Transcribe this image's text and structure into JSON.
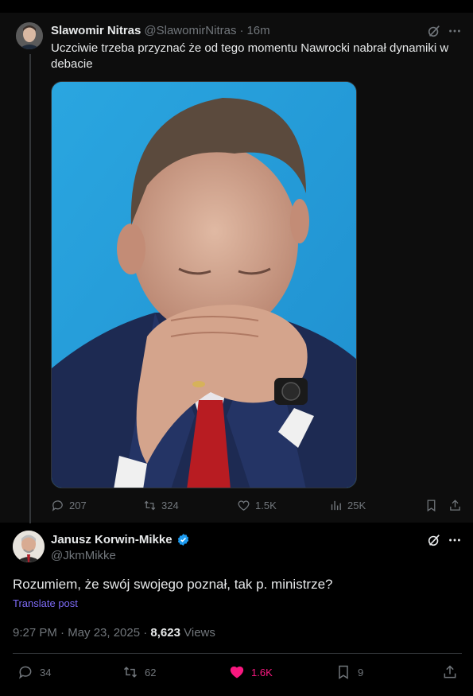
{
  "parent_tweet": {
    "author_name": "Slawomir Nitras",
    "author_handle": "@SlawomirNitras",
    "separator": "·",
    "time_ago": "16m",
    "text": "Uczciwie trzeba przyznać że od tego momentu Nawrocki nabrał dynamiki w debacie",
    "stats": {
      "replies": "207",
      "reposts": "324",
      "likes": "1.5K",
      "views": "25K"
    }
  },
  "reply_tweet": {
    "author_name": "Janusz Korwin-Mikke",
    "author_handle": "@JkmMikke",
    "text": "Rozumiem, że swój swojego poznał, tak p. ministrze?",
    "translate_label": "Translate post",
    "time": "9:27 PM · May 23, 2025 · ",
    "views_count": "8,623",
    "views_label": " Views",
    "stats": {
      "replies": "34",
      "reposts": "62",
      "likes": "1.6K",
      "bookmarks": "9"
    }
  },
  "colors": {
    "background": "#000000",
    "muted_text": "#71767b",
    "main_text": "#e7e9ea",
    "like_active": "#f91880",
    "link": "#7d6bf5",
    "verified_badge": "#1d9bf0"
  },
  "icons": [
    "grok-icon",
    "more-icon",
    "reply-icon",
    "repost-icon",
    "like-icon",
    "views-icon",
    "bookmark-icon",
    "share-icon",
    "verified-badge-icon"
  ]
}
